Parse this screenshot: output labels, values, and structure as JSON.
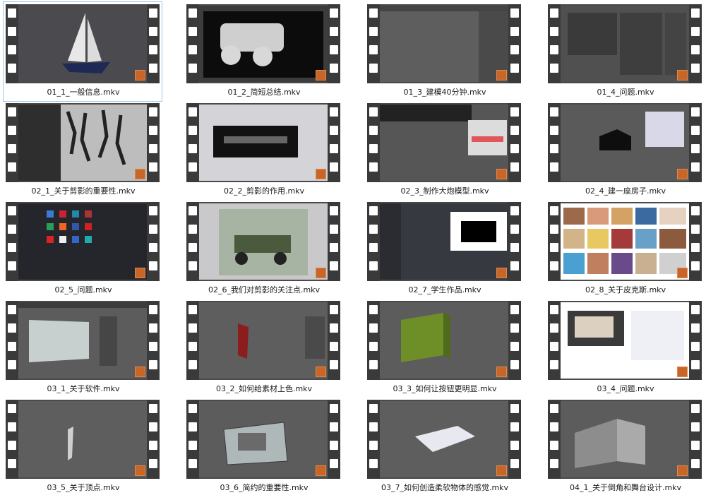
{
  "files": [
    {
      "name": "01_1_一般信息.mkv",
      "scene": "sailboat",
      "selected": true
    },
    {
      "name": "01_2_简短总结.mkv",
      "scene": "dark-model",
      "selected": false
    },
    {
      "name": "01_3_建模40分钟.mkv",
      "scene": "grey-app",
      "selected": false
    },
    {
      "name": "01_4_问题.mkv",
      "scene": "panels",
      "selected": false
    },
    {
      "name": "02_1_关于剪影的重要性.mkv",
      "scene": "silhouettes",
      "selected": false
    },
    {
      "name": "02_2_剪影的作用.mkv",
      "scene": "weapon",
      "selected": false
    },
    {
      "name": "02_3_制作大炮模型.mkv",
      "scene": "cannon",
      "selected": false
    },
    {
      "name": "02_4_建一座房子.mkv",
      "scene": "house",
      "selected": false
    },
    {
      "name": "02_5_问题.mkv",
      "scene": "app-icons",
      "selected": false
    },
    {
      "name": "02_6_我们对剪影的关注点.mkv",
      "scene": "truck",
      "selected": false
    },
    {
      "name": "02_7_学生作品.mkv",
      "scene": "chat",
      "selected": false
    },
    {
      "name": "02_8_关于皮克斯.mkv",
      "scene": "collage",
      "selected": false
    },
    {
      "name": "03_1_关于软件.mkv",
      "scene": "software",
      "selected": false
    },
    {
      "name": "03_2_如何给素材上色.mkv",
      "scene": "color",
      "selected": false
    },
    {
      "name": "03_3_如何让按钮更明显.mkv",
      "scene": "green-block",
      "selected": false
    },
    {
      "name": "03_4_问题.mkv",
      "scene": "browser",
      "selected": false
    },
    {
      "name": "03_5_关于顶点.mkv",
      "scene": "vertex",
      "selected": false
    },
    {
      "name": "03_6_简约的重要性.mkv",
      "scene": "ruin",
      "selected": false
    },
    {
      "name": "03_7_如何创造柔软物体的感觉.mkv",
      "scene": "soft",
      "selected": false
    },
    {
      "name": "04_1_关于倒角和舞台设计.mkv",
      "scene": "bevel",
      "selected": false
    }
  ]
}
